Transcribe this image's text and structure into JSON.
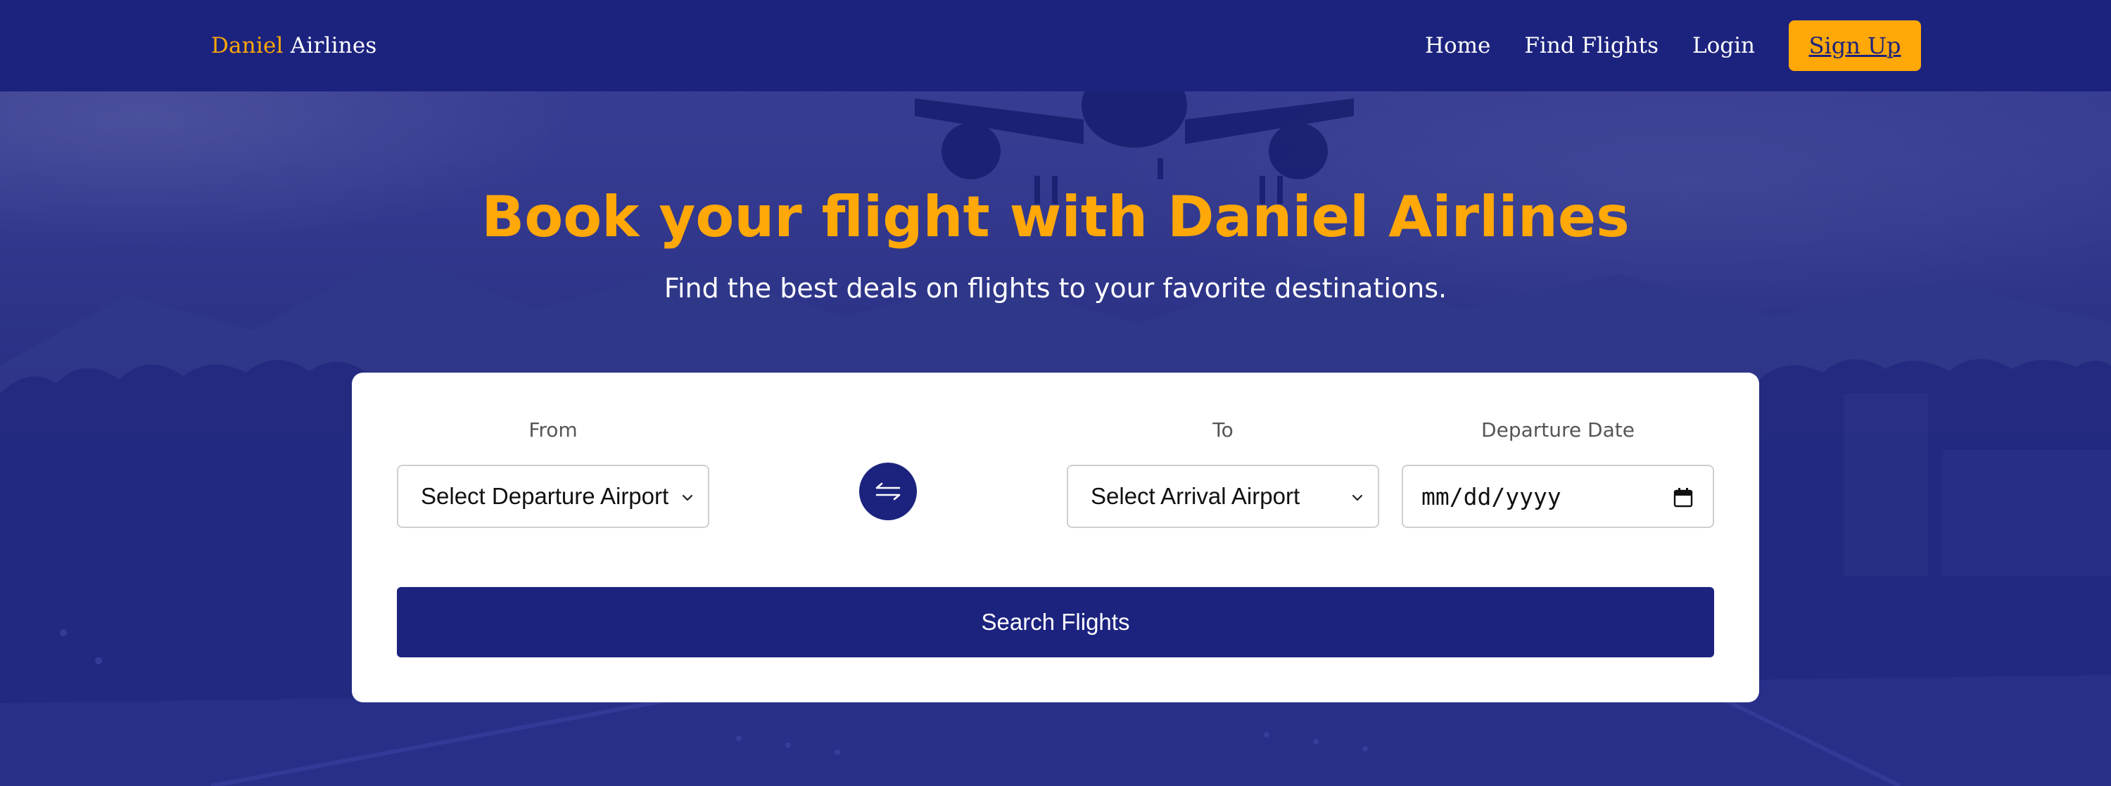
{
  "brand": {
    "first": "Daniel",
    "second": " Airlines"
  },
  "nav": {
    "home": "Home",
    "find_flights": "Find Flights",
    "login": "Login",
    "sign_up": "Sign Up"
  },
  "hero": {
    "title": "Book your flight with Daniel Airlines",
    "subtitle": "Find the best deals on flights to your favorite destinations."
  },
  "search_form": {
    "from_label": "From",
    "from_value": "Select Departure Airport",
    "to_label": "To",
    "to_value": "Select Arrival Airport",
    "date_label": "Departure Date",
    "date_placeholder": "mm/dd/yyyy",
    "swap_icon": "swap-arrows-icon",
    "search_label": "Search Flights"
  },
  "colors": {
    "brand_navy": "#1c237e",
    "accent_orange": "#ffa807",
    "card_white": "#ffffff"
  }
}
